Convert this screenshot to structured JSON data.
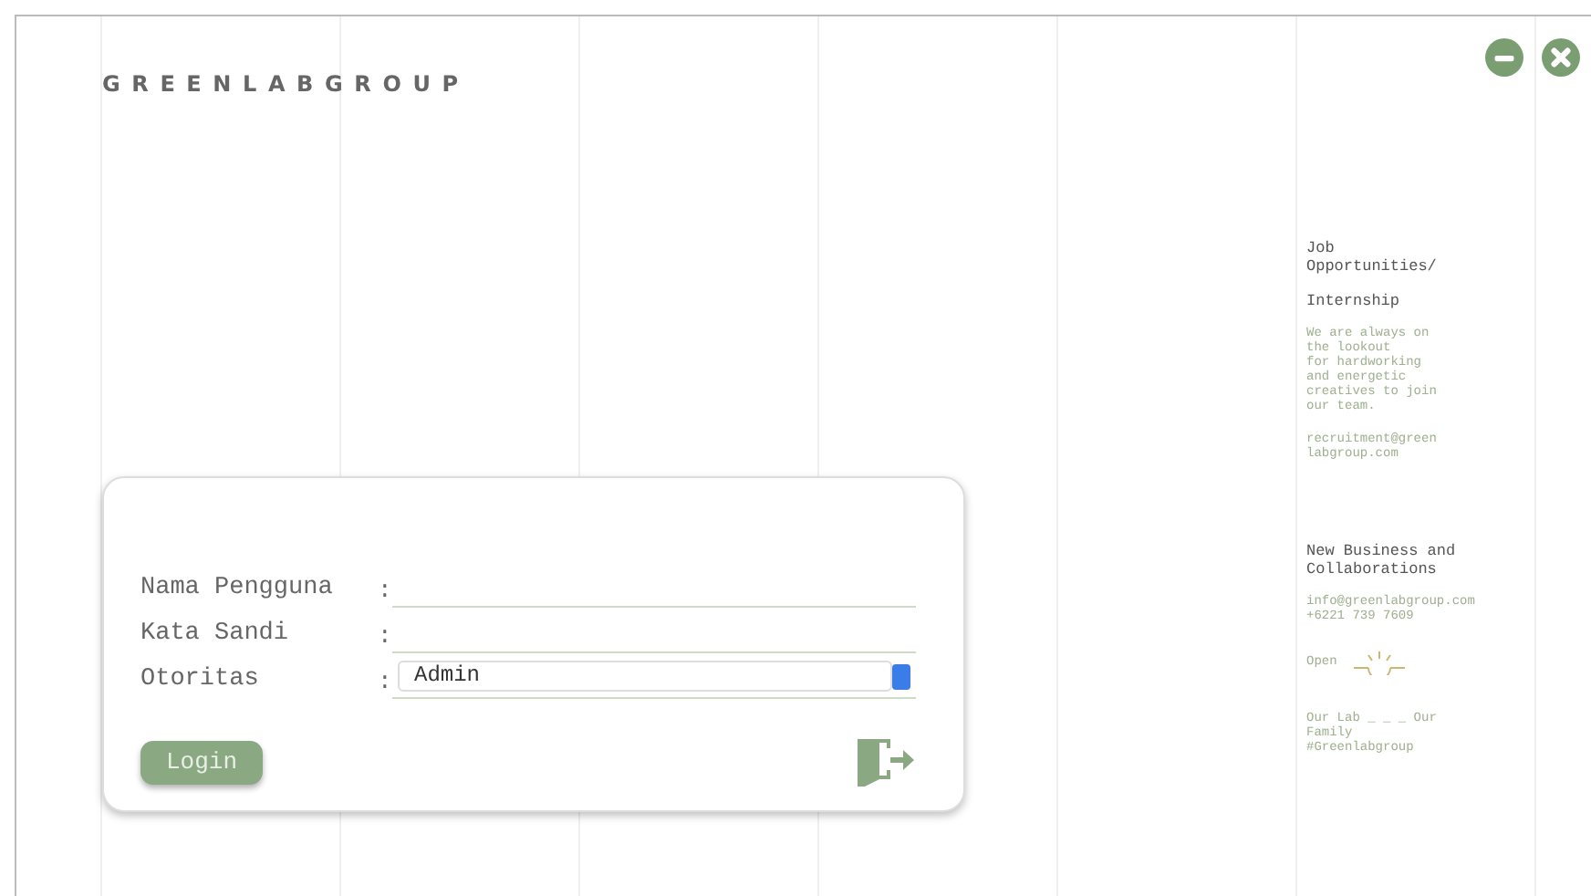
{
  "brand": "GREENLABGROUP",
  "window_controls": [
    {
      "kind": "minimize"
    },
    {
      "kind": "close"
    }
  ],
  "login": {
    "fields": [
      {
        "label": "Nama Pengguna",
        "separator": ":",
        "kind": "text"
      },
      {
        "label": "Kata Sandi",
        "separator": ":",
        "kind": "password"
      },
      {
        "label": "Otoritas",
        "separator": ":",
        "kind": "select",
        "value": "Admin"
      }
    ],
    "button": "Login"
  },
  "sidebar": [
    {
      "kind": "heading",
      "text": "Job\nOpportunities/"
    },
    {
      "kind": "heading",
      "text": "Internship"
    },
    {
      "kind": "body",
      "text": "We are always on\nthe lookout\nfor hardworking\nand energetic\ncreatives to join\nour team."
    },
    {
      "kind": "body",
      "text": "recruitment@green\nlabgroup.com"
    },
    {
      "kind": "gap"
    },
    {
      "kind": "heading",
      "text": "New Business and\nCollaborations"
    },
    {
      "kind": "body",
      "text": "info@greenlabgroup.com\n+6221 739 7609"
    },
    {
      "kind": "open",
      "text": "Open"
    },
    {
      "kind": "body",
      "text": "Our Lab _ _ _ Our\nFamily\n#Greenlabgroup"
    }
  ]
}
